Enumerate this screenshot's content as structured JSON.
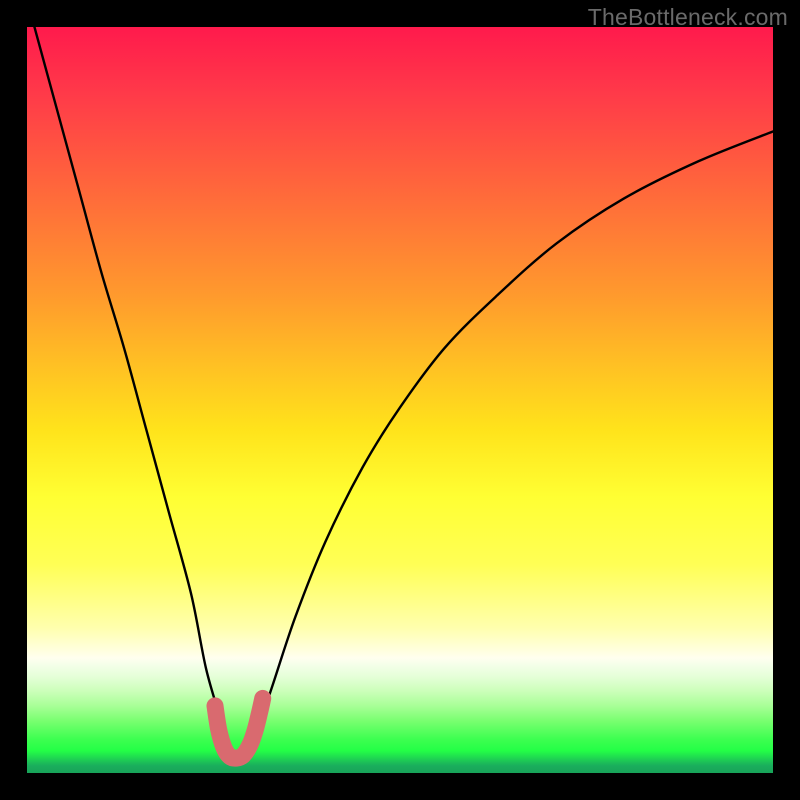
{
  "watermark": "TheBottleneck.com",
  "chart_data": {
    "type": "line",
    "title": "",
    "xlabel": "",
    "ylabel": "",
    "xlim": [
      0,
      100
    ],
    "ylim": [
      0,
      100
    ],
    "series": [
      {
        "name": "bottleneck-curve",
        "x": [
          1,
          4,
          7,
          10,
          13,
          16,
          19,
          22,
          24,
          26,
          27,
          28,
          29,
          30,
          31,
          33,
          36,
          40,
          45,
          50,
          56,
          63,
          71,
          80,
          90,
          100
        ],
        "y": [
          100,
          89,
          78,
          67,
          57,
          46,
          35,
          24,
          14,
          7,
          3,
          2,
          2,
          3,
          6,
          12,
          21,
          31,
          41,
          49,
          57,
          64,
          71,
          77,
          82,
          86
        ]
      },
      {
        "name": "highlight-region",
        "x": [
          25.2,
          25.7,
          26.4,
          27.2,
          28.1,
          29.0,
          29.9,
          30.6,
          31.2,
          31.6
        ],
        "y": [
          9.0,
          5.8,
          3.4,
          2.2,
          2.0,
          2.4,
          3.8,
          5.8,
          8.2,
          10.0
        ]
      }
    ],
    "gradient_stops": [
      {
        "pos": 0.0,
        "color": "#ff1a4c"
      },
      {
        "pos": 0.09,
        "color": "#ff3a49"
      },
      {
        "pos": 0.18,
        "color": "#ff5a3f"
      },
      {
        "pos": 0.27,
        "color": "#ff7a36"
      },
      {
        "pos": 0.36,
        "color": "#ff9a2d"
      },
      {
        "pos": 0.45,
        "color": "#ffbf24"
      },
      {
        "pos": 0.54,
        "color": "#ffe31b"
      },
      {
        "pos": 0.63,
        "color": "#ffff33"
      },
      {
        "pos": 0.72,
        "color": "#ffff55"
      },
      {
        "pos": 0.805,
        "color": "#ffffad"
      },
      {
        "pos": 0.846,
        "color": "#ffffef"
      },
      {
        "pos": 0.856,
        "color": "#f3ffe8"
      },
      {
        "pos": 0.87,
        "color": "#e6ffd9"
      },
      {
        "pos": 0.89,
        "color": "#ccffba"
      },
      {
        "pos": 0.91,
        "color": "#a8ff97"
      },
      {
        "pos": 0.93,
        "color": "#79ff70"
      },
      {
        "pos": 0.955,
        "color": "#3cff50"
      },
      {
        "pos": 0.97,
        "color": "#24ff46"
      },
      {
        "pos": 0.99,
        "color": "#1aae5c"
      },
      {
        "pos": 1.0,
        "color": "#18a359"
      }
    ],
    "colors": {
      "curve": "#000000",
      "highlight": "#d96a6f",
      "frame": "#000000"
    }
  }
}
